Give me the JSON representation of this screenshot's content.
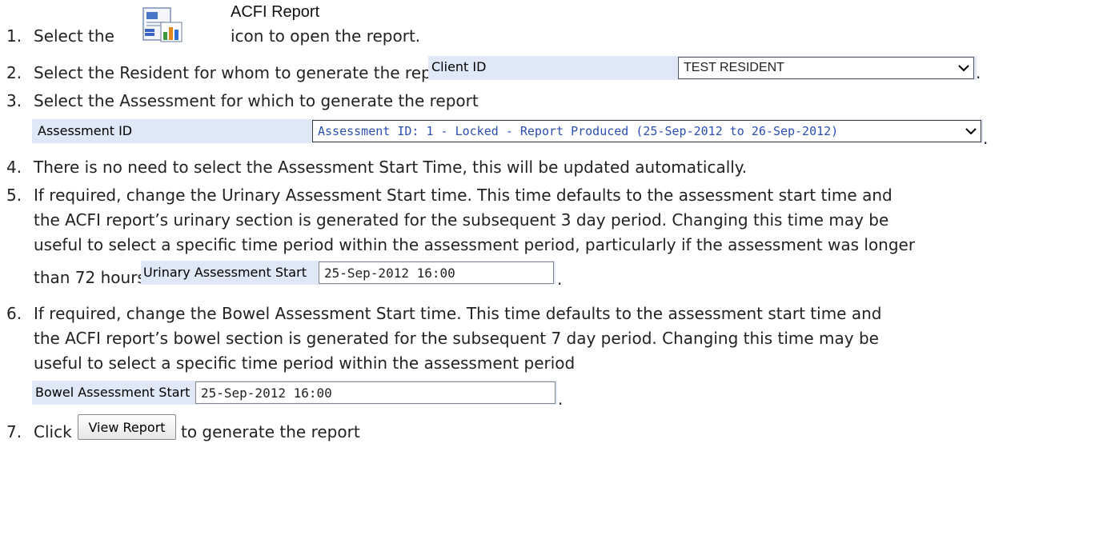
{
  "steps": [
    {
      "num": "1.",
      "pre": "Select the",
      "post": "icon to open the report."
    },
    {
      "num": "2.",
      "text": "Select the Resident for whom to generate the report",
      "end": "."
    },
    {
      "num": "3.",
      "text": "Select the Assessment for which to generate the report",
      "end": "."
    },
    {
      "num": "4.",
      "text": "There is no need to select the Assessment Start Time, this will be updated automatically."
    },
    {
      "num": "5.",
      "lines": [
        "If required, change the Urinary Assessment Start time.  This time defaults to the assessment start time and",
        "the ACFI report’s urinary section is generated for the subsequent 3 day period.  Changing this time may be",
        "useful to select a specific time period within the assessment period, particularly if the assessment was longer",
        "than 72 hours"
      ],
      "end": "."
    },
    {
      "num": "6.",
      "lines": [
        "If required, change the Bowel Assessment Start time.  This time defaults to the assessment start time and",
        "the ACFI report’s bowel section is generated for the subsequent 7 day period.  Changing this time may be",
        "useful to select a specific time period within the assessment period"
      ],
      "end": "."
    },
    {
      "num": "7.",
      "pre": "Click",
      "post": "to generate the report"
    }
  ],
  "report": {
    "label": "ACFI Report",
    "icon": "report-icon"
  },
  "client": {
    "label": "Client ID",
    "value": "TEST RESIDENT"
  },
  "assessment": {
    "label": "Assessment ID",
    "value": "Assessment ID: 1 - Locked - Report Produced (25-Sep-2012 to 26-Sep-2012)"
  },
  "urinary": {
    "label": "Urinary Assessment Start",
    "value": "25-Sep-2012 16:00"
  },
  "bowel": {
    "label": "Bowel Assessment Start",
    "value": "25-Sep-2012 16:00"
  },
  "view_button": {
    "label": "View Report"
  },
  "colors": {
    "panel": "#dfe8f6",
    "assessment_text": "#2a4fb0"
  }
}
